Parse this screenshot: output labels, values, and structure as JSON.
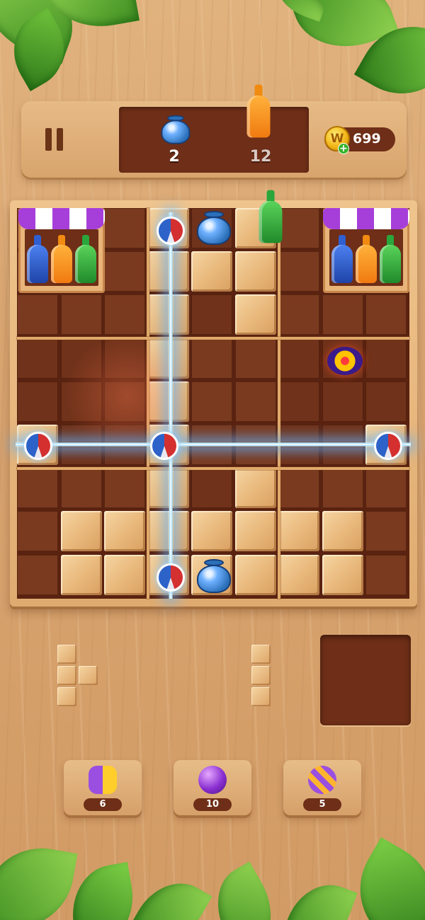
{
  "header": {
    "goals": [
      {
        "icon": "blue-pot-icon",
        "count": "2"
      },
      {
        "icon": "orange-bottle-icon",
        "count": "12"
      }
    ],
    "coins": {
      "value": "699",
      "icon_letter": "W",
      "plus": "+"
    }
  },
  "boosters": [
    {
      "icon": "swap-arrows-icon",
      "count": "6"
    },
    {
      "icon": "purple-bomb-icon",
      "count": "10"
    },
    {
      "icon": "striped-ball-icon",
      "count": "5"
    }
  ],
  "colors": {
    "board_dark": "#7a3a1f",
    "wood_light": "#f6d5a2",
    "lightning": "#9fdcff",
    "bottle_blue": "#2f5fd0",
    "bottle_orange": "#f08a10",
    "bottle_green": "#2aa63a"
  }
}
